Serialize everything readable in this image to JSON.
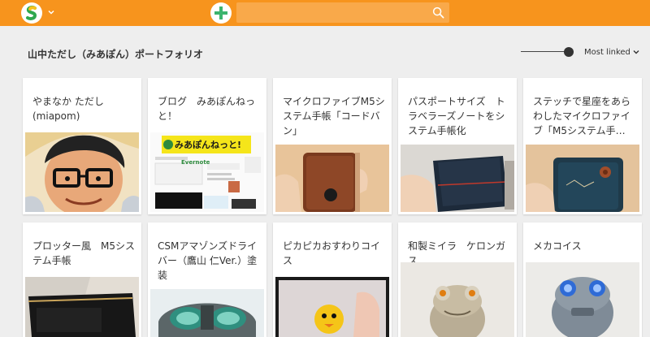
{
  "header": {
    "search_placeholder": ""
  },
  "page": {
    "title": "山中ただし（みあぽん）ポートフォリオ",
    "sort_label": "Most linked"
  },
  "colors": {
    "header": "#f7941d",
    "search": "#f9a94a",
    "background": "#eeeeee",
    "add_icon": "#3cb46e"
  },
  "icons": {
    "logo": "strikingly-logo-icon",
    "add": "plus-circle-icon",
    "search": "search-icon",
    "caret": "chevron-down-icon"
  },
  "cards": [
    {
      "title": "やまなか ただし (miapom)"
    },
    {
      "title": "ブログ　みあぽんねっと！",
      "thumb_text": "みあぽんねっと!",
      "thumb_sub": "Evernote"
    },
    {
      "title": "マイクロファイブM5システム手帳「コードバン」"
    },
    {
      "title": "パスポートサイズ　トラベラーズノートをシステム手帳化"
    },
    {
      "title": "ステッチで星座をあらわしたマイクロファイブ「M5システム手…"
    },
    {
      "title": "プロッター風　M5システム手帳"
    },
    {
      "title": "CSMアマゾンズドライバー（鷹山 仁Ver.）塗装"
    },
    {
      "title": "ピカピカおすわりコイス"
    },
    {
      "title": "和製ミイラ　ケロンガス"
    },
    {
      "title": "メカコイス"
    }
  ]
}
